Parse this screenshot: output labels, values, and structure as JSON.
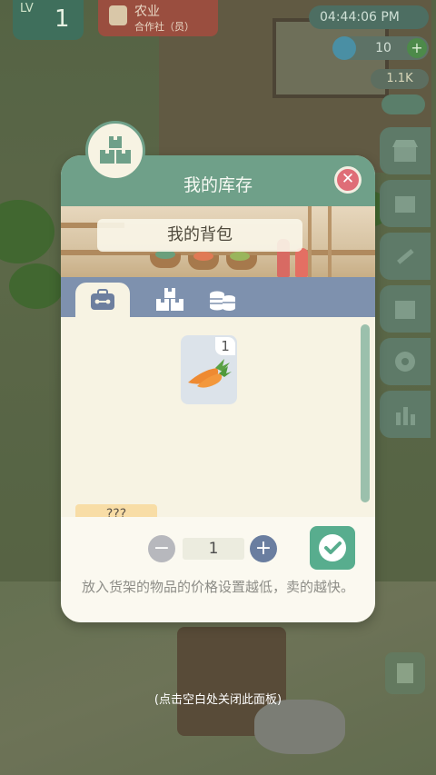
{
  "hud": {
    "level_prefix": "LV",
    "level": "1",
    "job_title": "农业",
    "job_subtitle": "合作社（员）",
    "clock": "04:44:06 PM",
    "gems": "10",
    "gold": "1.1K"
  },
  "panel": {
    "title": "我的库存",
    "bag_label": "我的背包",
    "tabs": [
      {
        "name": "bag",
        "icon": "backpack-icon"
      },
      {
        "name": "boxes",
        "icon": "boxes-icon"
      },
      {
        "name": "coins",
        "icon": "coins-icon"
      }
    ],
    "active_tab": 0,
    "items": [
      {
        "icon": "carrot-icon",
        "count": "1"
      }
    ],
    "selected_name": "???",
    "quantity": "1",
    "minus_label": "−",
    "plus_label": "+",
    "close_label": "✕",
    "hint": "放入货架的物品的价格设置越低，卖的越快。"
  },
  "dismiss_hint": "(点击空白处关闭此面板)",
  "colors": {
    "header_green": "#6fa089",
    "tab_blue": "#7e91ae",
    "confirm_green": "#58ad8e",
    "close_red": "#df6d77",
    "name_tag": "#f8dda6"
  }
}
